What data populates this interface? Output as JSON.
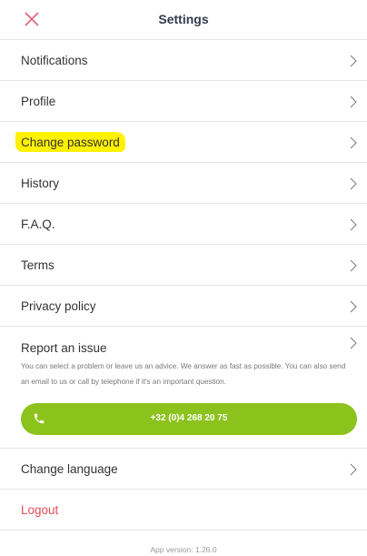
{
  "header": {
    "title": "Settings",
    "close_icon": "close-icon"
  },
  "menu": [
    {
      "label": "Notifications",
      "icon": "chevron-right-icon"
    },
    {
      "label": "Profile",
      "icon": "chevron-right-icon"
    },
    {
      "label": "Change password",
      "icon": "chevron-right-icon",
      "highlighted": true
    },
    {
      "label": "History",
      "icon": "chevron-right-icon"
    },
    {
      "label": "F.A.Q.",
      "icon": "chevron-right-icon"
    },
    {
      "label": "Terms",
      "icon": "chevron-right-icon"
    },
    {
      "label": "Privacy policy",
      "icon": "chevron-right-icon"
    }
  ],
  "report": {
    "title": "Report an issue",
    "description": "You can select a problem or leave us an advice. We answer as fast as possible. You can also send an email to us or call by telephone if it's an important question.",
    "phone_label": "+32 (0)4 268 20 75",
    "phone_icon": "phone-icon"
  },
  "language": {
    "label": "Change language",
    "icon": "chevron-right-icon"
  },
  "logout": {
    "label": "Logout"
  },
  "footer": {
    "version": "App version: 1.26.0"
  },
  "colors": {
    "accent_close": "#e0607a",
    "phone_button": "#8bc21c",
    "logout": "#e44d5a",
    "highlight": "#fff200"
  }
}
